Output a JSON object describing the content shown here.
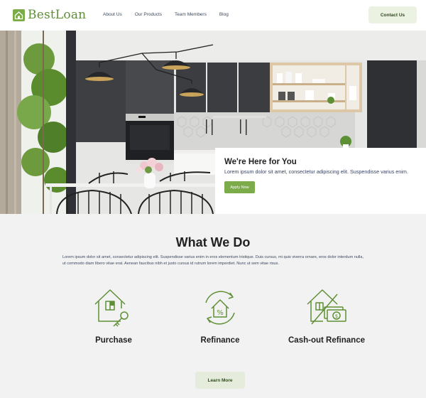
{
  "header": {
    "logo_text": "BestLoan",
    "nav": [
      "About Us",
      "Our Products",
      "Team Members",
      "Blog"
    ],
    "contact_label": "Contact Us"
  },
  "hero": {
    "title": "We're Here for You",
    "text": "Lorem ipsum dolor sit amet, consectetur adipiscing elit. Suspendisse varius enim.",
    "apply_label": "Apply Now"
  },
  "what_we_do": {
    "title": "What We Do",
    "text": "Lorem ipsum dolor sit amet, consectetur adipiscing elit. Suspendisse varius enim in eros elementum tristique. Duis cursus, mi quis viverra ornare, eros dolor interdum nulla, ut commodo diam libero vitae erat. Aenean faucibus nibh et justo cursus id rutrum lorem imperdiet. Nunc ut sem vitae risus.",
    "services": [
      {
        "label": "Purchase",
        "icon": "house-key-icon"
      },
      {
        "label": "Refinance",
        "icon": "house-percent-refresh-icon"
      },
      {
        "label": "Cash-out Refinance",
        "icon": "house-cash-icon"
      }
    ],
    "learn_label": "Learn More"
  },
  "colors": {
    "brand_green": "#7cab4a",
    "button_bg": "#ebf2e1",
    "section_bg": "#f2f2f2"
  }
}
